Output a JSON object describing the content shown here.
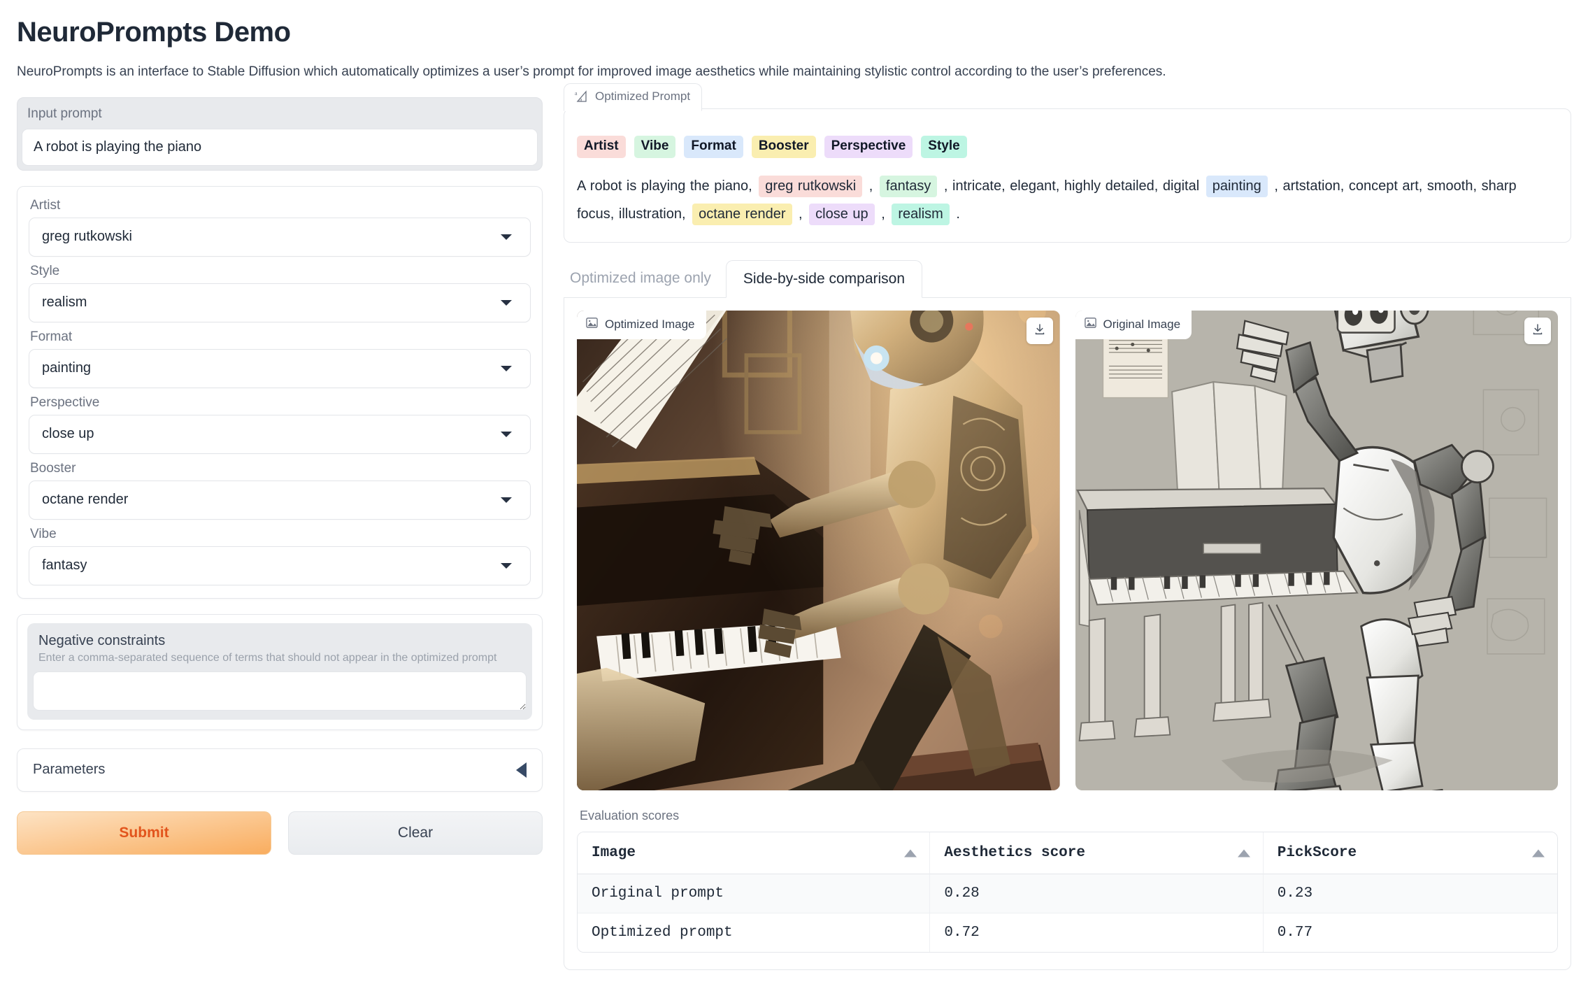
{
  "header": {
    "title": "NeuroPrompts Demo",
    "subtitle": "NeuroPrompts is an interface to Stable Diffusion which automatically optimizes a user’s prompt for improved image aesthetics while maintaining stylistic control according to the user’s preferences."
  },
  "input": {
    "label": "Input prompt",
    "value": "A robot is playing the piano",
    "placeholder": ""
  },
  "dropdowns": [
    {
      "label": "Artist",
      "value": "greg rutkowski",
      "icon": "chevron-down-icon"
    },
    {
      "label": "Style",
      "value": "realism",
      "icon": "chevron-down-icon"
    },
    {
      "label": "Format",
      "value": "painting",
      "icon": "chevron-down-icon"
    },
    {
      "label": "Perspective",
      "value": "close up",
      "icon": "chevron-down-icon"
    },
    {
      "label": "Booster",
      "value": "octane render",
      "icon": "chevron-down-icon"
    },
    {
      "label": "Vibe",
      "value": "fantasy",
      "icon": "chevron-down-icon"
    }
  ],
  "negative": {
    "label": "Negative constraints",
    "hint": "Enter a comma-separated sequence of terms that should not appear in the optimized prompt",
    "value": ""
  },
  "parameters": {
    "label": "Parameters",
    "icon": "triangle-left-icon",
    "expanded": false
  },
  "buttons": {
    "submit": "Submit",
    "clear": "Clear"
  },
  "optimized_prompt": {
    "tab_label": "Optimized Prompt",
    "tab_icon": "text-diff-icon",
    "legend": [
      {
        "label": "Artist",
        "color": "#fadcd9"
      },
      {
        "label": "Vibe",
        "color": "#d6f5e0"
      },
      {
        "label": "Format",
        "color": "#d9e8fb"
      },
      {
        "label": "Booster",
        "color": "#faeeb0"
      },
      {
        "label": "Perspective",
        "color": "#eddcfa"
      },
      {
        "label": "Style",
        "color": "#bdf5e3"
      }
    ],
    "tokens": [
      {
        "text": "A robot is playing the piano, ",
        "color": null
      },
      {
        "text": "greg rutkowski",
        "color": "#fadcd9"
      },
      {
        "text": " , ",
        "color": null
      },
      {
        "text": "fantasy",
        "color": "#d6f5e0"
      },
      {
        "text": " , intricate, elegant, highly detailed, digital ",
        "color": null
      },
      {
        "text": "painting",
        "color": "#d9e8fb"
      },
      {
        "text": " , artstation, concept art, smooth, sharp focus, illustration, ",
        "color": null
      },
      {
        "text": "octane render",
        "color": "#faeeb0"
      },
      {
        "text": " , ",
        "color": null
      },
      {
        "text": "close up",
        "color": "#eddcfa"
      },
      {
        "text": " , ",
        "color": null
      },
      {
        "text": "realism",
        "color": "#bdf5e3"
      },
      {
        "text": " .",
        "color": null
      }
    ]
  },
  "image_tabs": [
    {
      "label": "Optimized image only",
      "active": false
    },
    {
      "label": "Side-by-side comparison",
      "active": true
    }
  ],
  "images": [
    {
      "badge": "Optimized Image",
      "badge_icon": "image-icon",
      "download_icon": "download-icon",
      "variant": "optimized"
    },
    {
      "badge": "Original Image",
      "badge_icon": "image-icon",
      "download_icon": "download-icon",
      "variant": "original"
    }
  ],
  "evaluation": {
    "label": "Evaluation scores",
    "columns": [
      "Image",
      "Aesthetics score",
      "PickScore"
    ],
    "sort_icon": "sort-ascending-icon",
    "rows": [
      {
        "image": "Original prompt",
        "aesthetics": "0.28",
        "pickscore": "0.23"
      },
      {
        "image": "Optimized prompt",
        "aesthetics": "0.72",
        "pickscore": "0.77"
      }
    ]
  },
  "chart_data": {
    "type": "table",
    "title": "Evaluation scores",
    "categories": [
      "Original prompt",
      "Optimized prompt"
    ],
    "series": [
      {
        "name": "Aesthetics score",
        "values": [
          0.28,
          0.72
        ]
      },
      {
        "name": "PickScore",
        "values": [
          0.23,
          0.77
        ]
      }
    ]
  }
}
